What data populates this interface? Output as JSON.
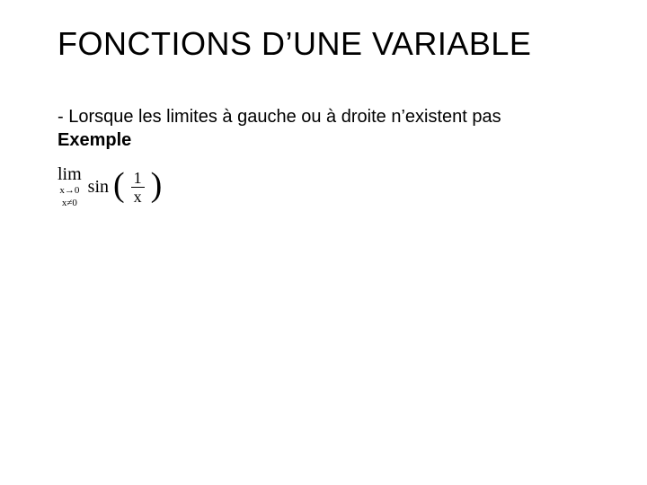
{
  "title": "FONCTIONS D’UNE VARIABLE",
  "body": {
    "line1": "- Lorsque les limites à gauche ou à droite n’existent pas",
    "line2": "Exemple"
  },
  "formula": {
    "lim": "lim",
    "sub1": "x→0",
    "sub2": "x≠0",
    "fn": "sin",
    "lparen": "(",
    "rparen": ")",
    "num": "1",
    "den": "x"
  }
}
